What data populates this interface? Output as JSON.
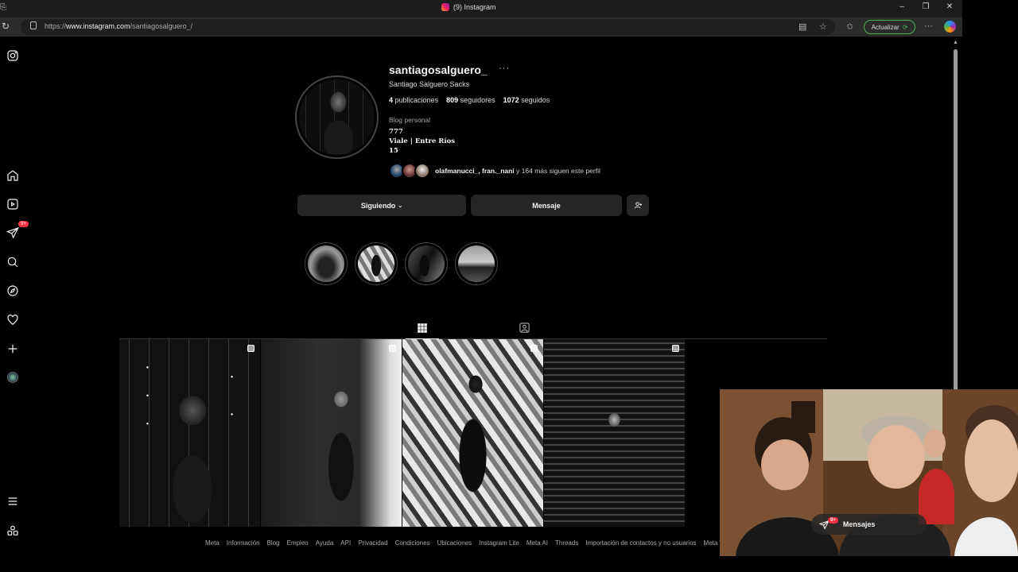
{
  "browser": {
    "tab_title": "(9) Instagram",
    "url_prefix": "https://",
    "url_host": "www.instagram.com",
    "url_path": "/santiagosalguero_/",
    "update_label": "Actualizar"
  },
  "sidebar": {
    "notifications_badge": "9+"
  },
  "profile": {
    "username": "santiagosalguero_",
    "more": "···",
    "full_name": "Santiago Salguero Sacks",
    "posts_count": "4",
    "posts_label": "publicaciones",
    "followers_count": "809",
    "followers_label": "seguidores",
    "following_count": "1072",
    "following_label": "seguidos",
    "category": "Blog personal",
    "bio_line1": "777",
    "bio_line2": "Viale | Entre Ríos",
    "bio_line3": "15",
    "followed_by_names": "olafmanucci_, fran._nani",
    "followed_by_rest": " y 164 más siguen este perfil"
  },
  "actions": {
    "following_label": "Siguiendo",
    "message_label": "Mensaje"
  },
  "footer": {
    "links": [
      "Meta",
      "Información",
      "Blog",
      "Empleo",
      "Ayuda",
      "API",
      "Privacidad",
      "Condiciones",
      "Ubicaciones",
      "Instagram Lite",
      "Meta AI",
      "Threads",
      "Importación de contactos y no usuarios",
      "Meta Verified"
    ]
  },
  "messages_pill": {
    "label": "Mensajes",
    "badge": "9+"
  }
}
